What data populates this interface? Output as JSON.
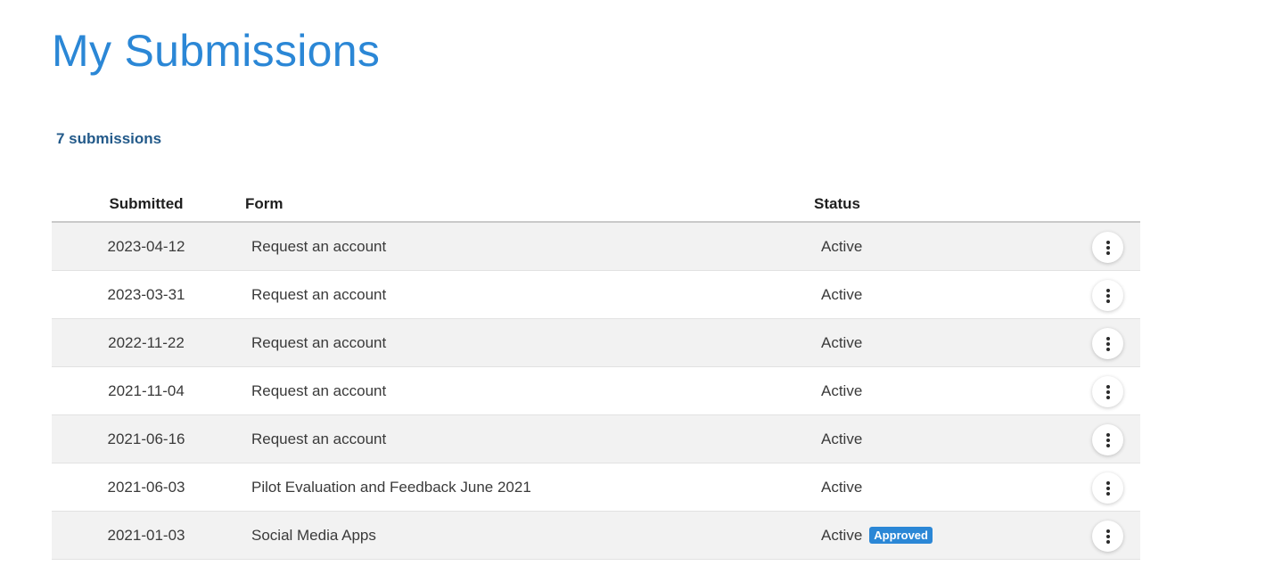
{
  "page": {
    "title": "My Submissions",
    "count_label": "7 submissions"
  },
  "table": {
    "columns": {
      "submitted": "Submitted",
      "form": "Form",
      "status": "Status"
    },
    "rows": [
      {
        "submitted": "2023-04-12",
        "form": "Request an account",
        "status": "Active",
        "badge": ""
      },
      {
        "submitted": "2023-03-31",
        "form": "Request an account",
        "status": "Active",
        "badge": ""
      },
      {
        "submitted": "2022-11-22",
        "form": "Request an account",
        "status": "Active",
        "badge": ""
      },
      {
        "submitted": "2021-11-04",
        "form": "Request an account",
        "status": "Active",
        "badge": ""
      },
      {
        "submitted": "2021-06-16",
        "form": "Request an account",
        "status": "Active",
        "badge": ""
      },
      {
        "submitted": "2021-06-03",
        "form": "Pilot Evaluation and Feedback June 2021",
        "status": "Active",
        "badge": ""
      },
      {
        "submitted": "2021-01-03",
        "form": "Social Media Apps",
        "status": "Active",
        "badge": "Approved"
      }
    ],
    "row_action_icon": "more-vertical-icon"
  },
  "colors": {
    "title": "#2b87d6",
    "count": "#235a8a",
    "badge_bg": "#2b87d6",
    "row_alt_bg": "#f2f2f2"
  }
}
